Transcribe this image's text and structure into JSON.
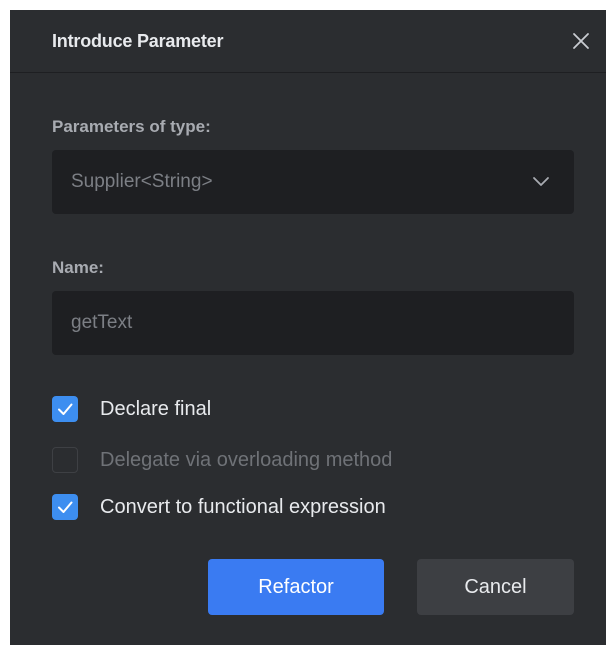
{
  "dialog": {
    "title": "Introduce Parameter",
    "close_icon": "close-icon"
  },
  "type_field": {
    "label": "Parameters of type:",
    "selected": "Supplier<String>",
    "dropdown_icon": "chevron-down-icon"
  },
  "name_field": {
    "label": "Name:",
    "value": "getText"
  },
  "options": [
    {
      "label": "Declare final",
      "checked": true,
      "enabled": true
    },
    {
      "label": "Delegate via overloading method",
      "checked": false,
      "enabled": false
    },
    {
      "label": "Convert to functional expression",
      "checked": true,
      "enabled": true
    }
  ],
  "buttons": {
    "refactor": "Refactor",
    "cancel": "Cancel"
  },
  "colors": {
    "dialog_bg": "#2b2d30",
    "field_bg": "#1e1f22",
    "accent": "#3a7bf2",
    "checkbox_checked": "#3d8ef0",
    "secondary_button": "#3d3f43"
  }
}
